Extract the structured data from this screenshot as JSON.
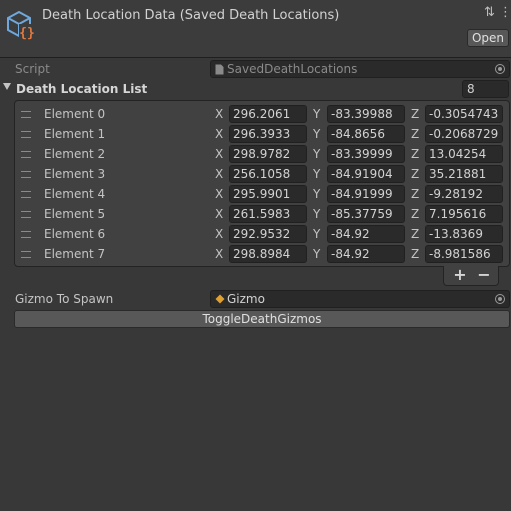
{
  "header": {
    "title": "Death Location Data (Saved Death Locations)",
    "open_label": "Open",
    "settings_icon": "sliders-icon",
    "menu_icon": "more-vert-icon",
    "asset_icon": "scriptable-object-icon"
  },
  "script_row": {
    "label": "Script",
    "value": "SavedDeathLocations"
  },
  "list": {
    "label": "Death Location List",
    "count": "8",
    "elements": [
      {
        "label": "Element 0",
        "x": "296.2061",
        "y": "-83.39988",
        "z": "-0.3054743"
      },
      {
        "label": "Element 1",
        "x": "296.3933",
        "y": "-84.8656",
        "z": "-0.2068729"
      },
      {
        "label": "Element 2",
        "x": "298.9782",
        "y": "-83.39999",
        "z": "13.04254"
      },
      {
        "label": "Element 3",
        "x": "256.1058",
        "y": "-84.91904",
        "z": "35.21881"
      },
      {
        "label": "Element 4",
        "x": "295.9901",
        "y": "-84.91999",
        "z": "-9.28192"
      },
      {
        "label": "Element 5",
        "x": "261.5983",
        "y": "-85.37759",
        "z": "7.195616"
      },
      {
        "label": "Element 6",
        "x": "292.9532",
        "y": "-84.92",
        "z": "-13.8369"
      },
      {
        "label": "Element 7",
        "x": "298.8984",
        "y": "-84.92",
        "z": "-8.981586"
      }
    ],
    "axis_labels": {
      "x": "X",
      "y": "Y",
      "z": "Z"
    },
    "add_label": "+",
    "remove_label": "−"
  },
  "gizmo": {
    "label": "Gizmo To Spawn",
    "value": "Gizmo"
  },
  "toggle_button": "ToggleDeathGizmos",
  "colors": {
    "background": "#383838",
    "field": "#2a2a2a",
    "button": "#585858",
    "text": "#c4c4c4",
    "accent_icon": "#6fa8dc",
    "accent_braces": "#e07a3f"
  }
}
